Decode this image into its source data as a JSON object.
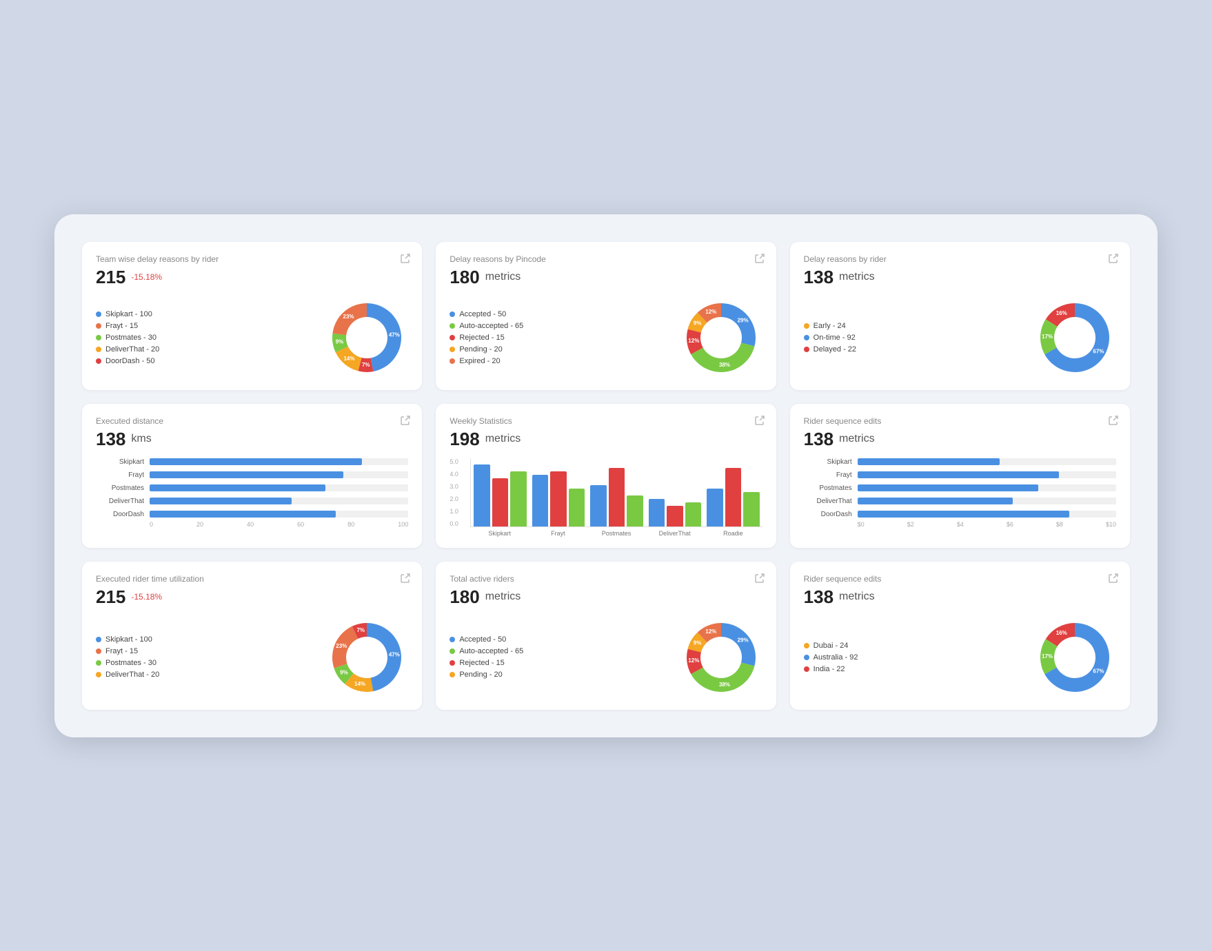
{
  "cards": [
    {
      "id": "team-delay",
      "title": "Team wise delay reasons by rider",
      "metric": "215",
      "badge": "-15.18%",
      "unit": null,
      "type": "donut",
      "legend": [
        {
          "label": "Skipkart - 100",
          "color": "#4a90e2"
        },
        {
          "label": "Frayt - 15",
          "color": "#e8734a"
        },
        {
          "label": "Postmates - 30",
          "color": "#7ac943"
        },
        {
          "label": "DeliverThat - 20",
          "color": "#f5a623"
        },
        {
          "label": "DoorDash - 50",
          "color": "#e04040"
        }
      ],
      "donut": {
        "segments": [
          {
            "pct": 47,
            "color": "#4a90e2",
            "label": "47%",
            "angle": 0
          },
          {
            "pct": 7,
            "color": "#e04040",
            "label": "7%",
            "angle": 169.2
          },
          {
            "pct": 14,
            "color": "#f5a623",
            "label": "14%",
            "angle": 194.4
          },
          {
            "pct": 9,
            "color": "#7ac943",
            "label": "9%",
            "angle": 244.8
          },
          {
            "pct": 23,
            "color": "#e8734a",
            "label": "23%",
            "angle": 277.2
          }
        ]
      }
    },
    {
      "id": "delay-pincode",
      "title": "Delay reasons by Pincode",
      "metric": "180",
      "badge": null,
      "unit": "metrics",
      "type": "donut",
      "legend": [
        {
          "label": "Accepted - 50",
          "color": "#4a90e2"
        },
        {
          "label": "Auto-accepted - 65",
          "color": "#7ac943"
        },
        {
          "label": "Rejected - 15",
          "color": "#e04040"
        },
        {
          "label": "Pending - 20",
          "color": "#f5a623"
        },
        {
          "label": "Expired - 20",
          "color": "#e8734a"
        }
      ],
      "donut": {
        "segments": [
          {
            "pct": 29,
            "color": "#4a90e2",
            "label": "29%"
          },
          {
            "pct": 38,
            "color": "#7ac943",
            "label": "38%"
          },
          {
            "pct": 12,
            "color": "#e04040",
            "label": "12%"
          },
          {
            "pct": 9,
            "color": "#f5a623",
            "label": "9%"
          },
          {
            "pct": 12,
            "color": "#e8734a",
            "label": "12%"
          }
        ]
      }
    },
    {
      "id": "delay-rider",
      "title": "Delay reasons by rider",
      "metric": "138",
      "badge": null,
      "unit": "metrics",
      "type": "donut",
      "legend": [
        {
          "label": "Early - 24",
          "color": "#f5a623"
        },
        {
          "label": "On-time - 92",
          "color": "#4a90e2"
        },
        {
          "label": "Delayed - 22",
          "color": "#e04040"
        }
      ],
      "donut": {
        "segments": [
          {
            "pct": 67,
            "color": "#4a90e2",
            "label": "67%"
          },
          {
            "pct": 17,
            "color": "#7ac943",
            "label": "17%"
          },
          {
            "pct": 16,
            "color": "#e04040",
            "label": "16%"
          }
        ]
      }
    },
    {
      "id": "exec-distance",
      "title": "Executed distance",
      "metric": "138",
      "badge": null,
      "unit": "kms",
      "type": "hbar",
      "bars": [
        {
          "label": "Skipkart",
          "pct": 82
        },
        {
          "label": "Frayt",
          "pct": 75
        },
        {
          "label": "Postmates",
          "pct": 68
        },
        {
          "label": "DeliverThat",
          "pct": 55
        },
        {
          "label": "DoorDash",
          "pct": 72
        }
      ],
      "axis": [
        "0",
        "20",
        "40",
        "60",
        "80",
        "100"
      ]
    },
    {
      "id": "weekly-stats",
      "title": "Weekly Statistics",
      "metric": "198",
      "badge": null,
      "unit": "metrics",
      "type": "grouped-bar",
      "groups": [
        {
          "label": "Skipkart",
          "bars": [
            {
              "value": 90,
              "color": "#4a90e2"
            },
            {
              "value": 70,
              "color": "#e04040"
            },
            {
              "value": 80,
              "color": "#7ac943"
            }
          ]
        },
        {
          "label": "Frayt",
          "bars": [
            {
              "value": 75,
              "color": "#4a90e2"
            },
            {
              "value": 80,
              "color": "#e04040"
            },
            {
              "value": 55,
              "color": "#7ac943"
            }
          ]
        },
        {
          "label": "Postmates",
          "bars": [
            {
              "value": 60,
              "color": "#4a90e2"
            },
            {
              "value": 85,
              "color": "#e04040"
            },
            {
              "value": 45,
              "color": "#7ac943"
            }
          ]
        },
        {
          "label": "DeliverThat",
          "bars": [
            {
              "value": 40,
              "color": "#4a90e2"
            },
            {
              "value": 30,
              "color": "#e04040"
            },
            {
              "value": 35,
              "color": "#7ac943"
            }
          ]
        },
        {
          "label": "Roadie",
          "bars": [
            {
              "value": 55,
              "color": "#4a90e2"
            },
            {
              "value": 85,
              "color": "#e04040"
            },
            {
              "value": 50,
              "color": "#7ac943"
            }
          ]
        }
      ],
      "yLabels": [
        "5.0",
        "4.0",
        "3.0",
        "2.0",
        "1.0",
        "0.0"
      ]
    },
    {
      "id": "rider-seq-edits",
      "title": "Rider sequence edits",
      "metric": "138",
      "badge": null,
      "unit": "metrics",
      "type": "hbar",
      "bars": [
        {
          "label": "Skipkart",
          "pct": 55
        },
        {
          "label": "Frayt",
          "pct": 78
        },
        {
          "label": "Postmates",
          "pct": 70
        },
        {
          "label": "DeliverThat",
          "pct": 60
        },
        {
          "label": "DoorDash",
          "pct": 82
        }
      ],
      "axis": [
        "$0",
        "$2",
        "$4",
        "$6",
        "$8",
        "$10"
      ]
    },
    {
      "id": "exec-rider-time",
      "title": "Executed rider time utilization",
      "metric": "215",
      "badge": "-15.18%",
      "unit": null,
      "type": "donut",
      "legend": [
        {
          "label": "Skipkart - 100",
          "color": "#4a90e2"
        },
        {
          "label": "Frayt - 15",
          "color": "#e8734a"
        },
        {
          "label": "Postmates - 30",
          "color": "#7ac943"
        },
        {
          "label": "DeliverThat - 20",
          "color": "#f5a623"
        }
      ],
      "donut": {
        "segments": [
          {
            "pct": 47,
            "color": "#4a90e2",
            "label": "47%"
          },
          {
            "pct": 14,
            "color": "#f5a623",
            "label": "14%"
          },
          {
            "pct": 9,
            "color": "#7ac943",
            "label": "9%"
          },
          {
            "pct": 23,
            "color": "#e8734a",
            "label": "23%"
          },
          {
            "pct": 7,
            "color": "#e04040",
            "label": "7%"
          }
        ]
      }
    },
    {
      "id": "total-active-riders",
      "title": "Total active riders",
      "metric": "180",
      "badge": null,
      "unit": "metrics",
      "type": "donut",
      "legend": [
        {
          "label": "Accepted - 50",
          "color": "#4a90e2"
        },
        {
          "label": "Auto-accepted - 65",
          "color": "#7ac943"
        },
        {
          "label": "Rejected - 15",
          "color": "#e04040"
        },
        {
          "label": "Pending - 20",
          "color": "#f5a623"
        }
      ],
      "donut": {
        "segments": [
          {
            "pct": 29,
            "color": "#4a90e2",
            "label": "29%"
          },
          {
            "pct": 38,
            "color": "#7ac943",
            "label": "38%"
          },
          {
            "pct": 12,
            "color": "#e04040",
            "label": "12%"
          },
          {
            "pct": 9,
            "color": "#f5a623",
            "label": "9%"
          },
          {
            "pct": 12,
            "color": "#e8734a",
            "label": "12%"
          }
        ]
      }
    },
    {
      "id": "rider-seq-edits-2",
      "title": "Rider sequence edits",
      "metric": "138",
      "badge": null,
      "unit": "metrics",
      "type": "donut",
      "legend": [
        {
          "label": "Dubai - 24",
          "color": "#f5a623"
        },
        {
          "label": "Australia - 92",
          "color": "#4a90e2"
        },
        {
          "label": "India - 22",
          "color": "#e04040"
        }
      ],
      "donut": {
        "segments": [
          {
            "pct": 67,
            "color": "#4a90e2",
            "label": "67%"
          },
          {
            "pct": 17,
            "color": "#7ac943",
            "label": "17%"
          },
          {
            "pct": 16,
            "color": "#e04040",
            "label": "16%"
          }
        ]
      }
    }
  ]
}
